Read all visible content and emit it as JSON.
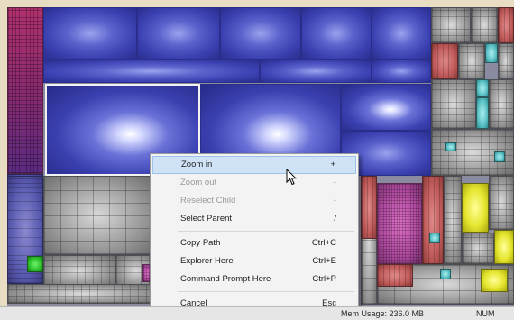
{
  "context_menu": {
    "items": [
      {
        "label": "Zoom in",
        "shortcut": "+",
        "state": "hover"
      },
      {
        "label": "Zoom out",
        "shortcut": "-",
        "state": "disabled"
      },
      {
        "label": "Reselect Child",
        "shortcut": "-",
        "state": "disabled"
      },
      {
        "label": "Select Parent",
        "shortcut": "/",
        "state": "normal"
      },
      {
        "label": "Copy Path",
        "shortcut": "Ctrl+C",
        "state": "normal"
      },
      {
        "label": "Explorer Here",
        "shortcut": "Ctrl+E",
        "state": "normal"
      },
      {
        "label": "Command Prompt Here",
        "shortcut": "Ctrl+P",
        "state": "normal"
      },
      {
        "label": "Cancel",
        "shortcut": "Esc",
        "state": "normal"
      }
    ]
  },
  "status_bar": {
    "memory_text": "Mem Usage:  236.0 MB",
    "num_indicator": "NUM"
  },
  "colors": {
    "menu_hover": "#cfe2f6",
    "selection_border": "#f2f2f2",
    "disabled_text": "#9a9a9a"
  },
  "icons": [
    "mouse-cursor-icon"
  ]
}
